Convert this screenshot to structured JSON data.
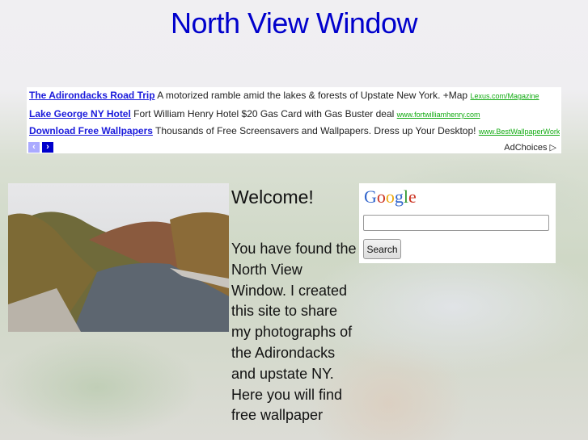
{
  "header": {
    "title": "North View Window"
  },
  "ads": {
    "items": [
      {
        "title": "The Adirondacks Road Trip",
        "text": "A motorized ramble amid the lakes & forests of Upstate New York. +Map",
        "url": "Lexus.com/Magazine"
      },
      {
        "title": "Lake George NY Hotel",
        "text": "Fort William Henry Hotel $20 Gas Card with Gas Buster deal",
        "url": "www.fortwilliamhenry.com"
      },
      {
        "title": "Download Free Wallpapers",
        "text": "Thousands of Free Screensavers and Wallpapers. Dress up Your Desktop!",
        "url": "www.BestWallpaperWork"
      }
    ],
    "prev_icon": "‹",
    "next_icon": "›",
    "adchoices_label": "AdChoices",
    "adchoices_icon": "▷",
    "colors": {
      "title": "#1a1adb",
      "url": "#11aa11",
      "nav_prev": "#aaaaff",
      "nav_next": "#0000cc"
    }
  },
  "main": {
    "photo_alt": "Adirondack river with autumn foliage and mountain",
    "welcome": "Welcome!",
    "body": "You have found the North View Window. I created this site to share my photographs of the Adirondacks and upstate NY. Here you will find free wallpaper"
  },
  "search": {
    "logo_letters": [
      "G",
      "o",
      "o",
      "g",
      "l",
      "e"
    ],
    "logo_colors": [
      "#3366cc",
      "#cc3322",
      "#eeaa11",
      "#3366cc",
      "#339933",
      "#cc3322"
    ],
    "input_value": "",
    "button_label": "Search"
  }
}
